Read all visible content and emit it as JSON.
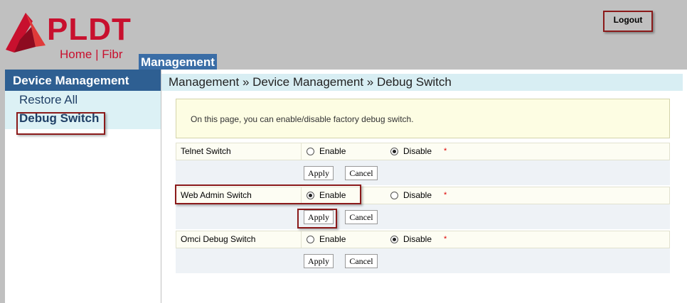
{
  "header": {
    "brand": "PLDT",
    "tagline": "Home | Fibr",
    "nav_tab": "Management",
    "logout_label": "Logout"
  },
  "sidebar": {
    "title": "Device Management",
    "items": [
      {
        "label": "Restore All"
      },
      {
        "label": "Debug Switch"
      }
    ]
  },
  "main": {
    "breadcrumb": "Management » Device Management » Debug Switch",
    "info": "On this page, you can enable/disable factory debug switch.",
    "switches": [
      {
        "label": "Telnet Switch",
        "enable": "Enable",
        "disable": "Disable",
        "selected": "disable",
        "required": "*",
        "apply": "Apply",
        "cancel": "Cancel"
      },
      {
        "label": "Web Admin Switch",
        "enable": "Enable",
        "disable": "Disable",
        "selected": "enable",
        "required": "*",
        "apply": "Apply",
        "cancel": "Cancel"
      },
      {
        "label": "Omci Debug Switch",
        "enable": "Enable",
        "disable": "Disable",
        "selected": "disable",
        "required": "*",
        "apply": "Apply",
        "cancel": "Cancel"
      }
    ]
  },
  "colors": {
    "brand_red": "#c8102e",
    "nav_blue": "#2e5f92",
    "annotation_red": "#8b1a1a"
  }
}
